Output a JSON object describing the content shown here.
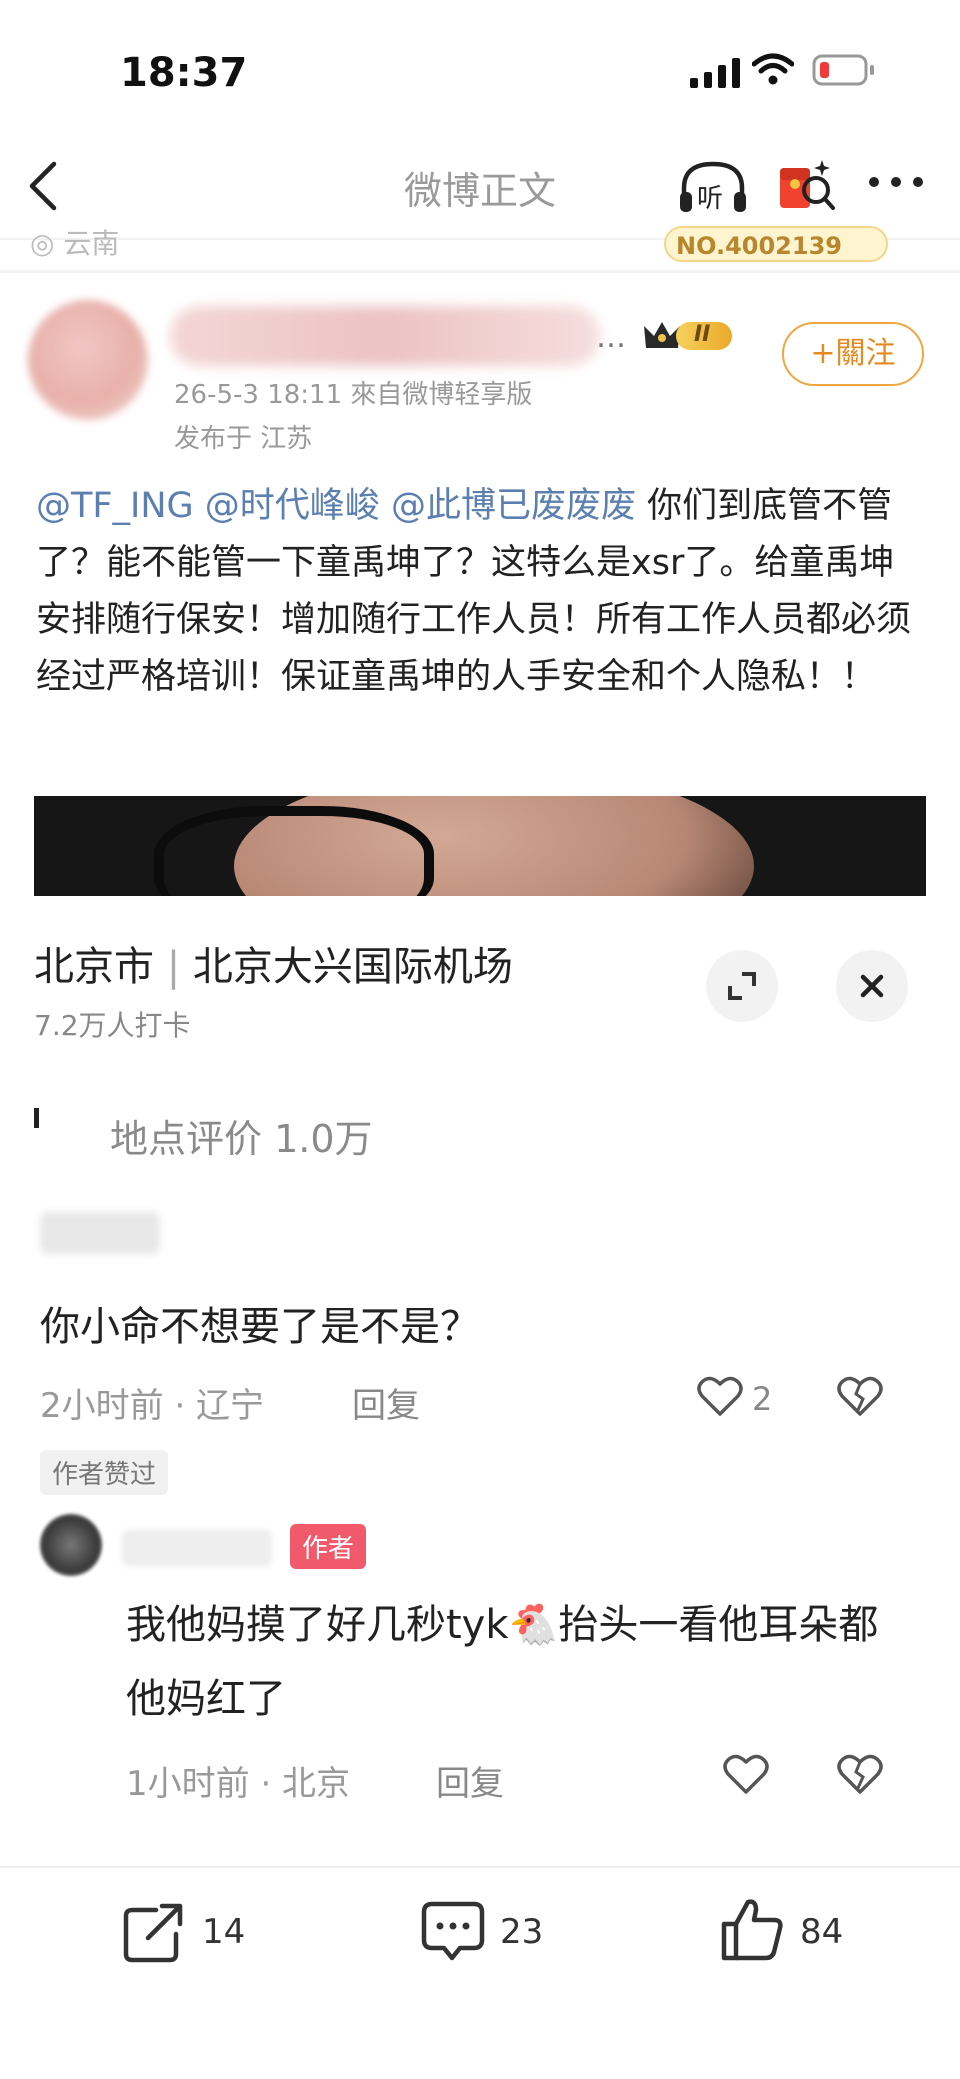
{
  "status": {
    "time": "18:37"
  },
  "nav": {
    "title": "微博正文",
    "listen_label": "听"
  },
  "prev_post": {
    "fragment": "◎ 云南",
    "badge": "NO.4002139"
  },
  "author": {
    "vip_level": "II",
    "follow_label": "+關注",
    "meta": "26-5-3 18:11  來自微博轻享版",
    "location": "发布于 江苏"
  },
  "post": {
    "mention1": "@TF_ING",
    "mention2": "@时代峰峻",
    "mention3": "@此博已废废废",
    "text": "你们到底管不管了？能不能管一下童禹坤了？这特么是xsr了。给童禹坤安排随行保安！增加随行工作人员！所有工作人员都必须经过严格培训！保证童禹坤的人手安全和个人隐私！！"
  },
  "place": {
    "city": "北京市",
    "name": "北京大兴国际机场",
    "checkins": "7.2万人打卡",
    "rating": "地点评价  1.0万"
  },
  "comments": [
    {
      "text": "你小命不想要了是不是？",
      "time": "2小时前 · 辽宁",
      "reply": "回复",
      "likes": "2",
      "tag": "作者赞过"
    },
    {
      "name_tag": "作者",
      "text": "我他妈摸了好几秒tyk🐔抬头一看他耳朵都他妈红了",
      "time": "1小时前 · 北京",
      "reply": "回复"
    }
  ],
  "bottom": {
    "shares": "14",
    "comments": "23",
    "likes": "84"
  },
  "colors": {
    "accent": "#f0a640",
    "mention": "#5b7fb0",
    "author_tag": "#f15a6a"
  }
}
